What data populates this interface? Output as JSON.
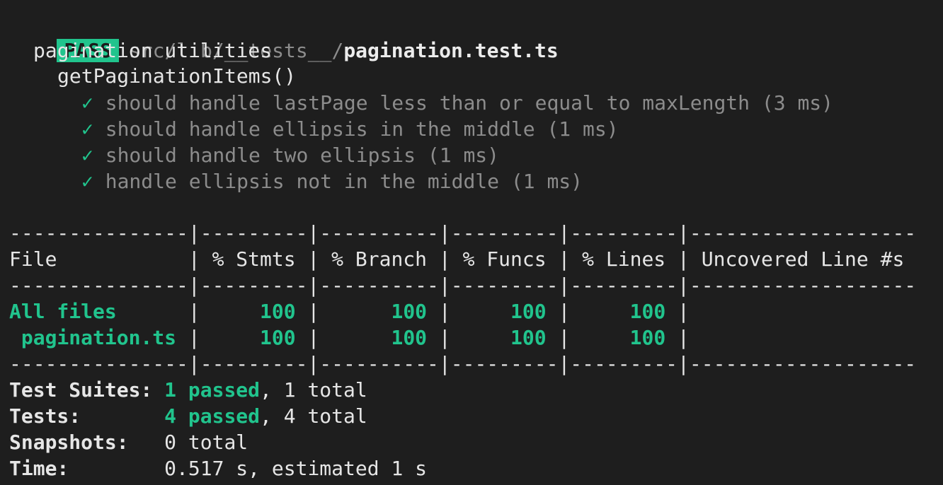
{
  "header": {
    "badge": "PASS",
    "path_dim": "src/lib/__tests__/",
    "path_file": "pagination.test.ts"
  },
  "describe": {
    "suite": "pagination utilities",
    "group": "getPaginationItems()",
    "tests": [
      {
        "check": "✓",
        "text": "should handle lastPage less than or equal to maxLength (3 ms)"
      },
      {
        "check": "✓",
        "text": "should handle ellipsis in the middle (1 ms)"
      },
      {
        "check": "✓",
        "text": "should handle two ellipsis (1 ms)"
      },
      {
        "check": "✓",
        "text": "handle ellipsis not in the middle (1 ms)"
      }
    ]
  },
  "coverage": {
    "separator": "---------------|---------|----------|---------|---------|-------------------",
    "header_row": "File           | % Stmts | % Branch | % Funcs | % Lines | Uncovered Line #s ",
    "rows": [
      {
        "file": "All files      ",
        "pipe1": "|",
        "stmts": "     100 ",
        "pipe2": "|",
        "branch": "      100 ",
        "pipe3": "|",
        "funcs": "     100 ",
        "pipe4": "|",
        "lines": "     100 ",
        "pipe5": "|"
      },
      {
        "file": " pagination.ts ",
        "pipe1": "|",
        "stmts": "     100 ",
        "pipe2": "|",
        "branch": "      100 ",
        "pipe3": "|",
        "funcs": "     100 ",
        "pipe4": "|",
        "lines": "     100 ",
        "pipe5": "|"
      }
    ]
  },
  "summary": {
    "suites_label": "Test Suites: ",
    "suites_passed": "1 passed",
    "suites_rest": ", 1 total",
    "tests_label": "Tests:       ",
    "tests_passed": "4 passed",
    "tests_rest": ", 4 total",
    "snapshots_label": "Snapshots:   ",
    "snapshots_value": "0 total",
    "time_label": "Time:        ",
    "time_value": "0.517 s, estimated 1 s"
  },
  "colors": {
    "background": "#1e1e1e",
    "accent_green": "#21c48d",
    "dim_text": "#8c8c8c"
  }
}
